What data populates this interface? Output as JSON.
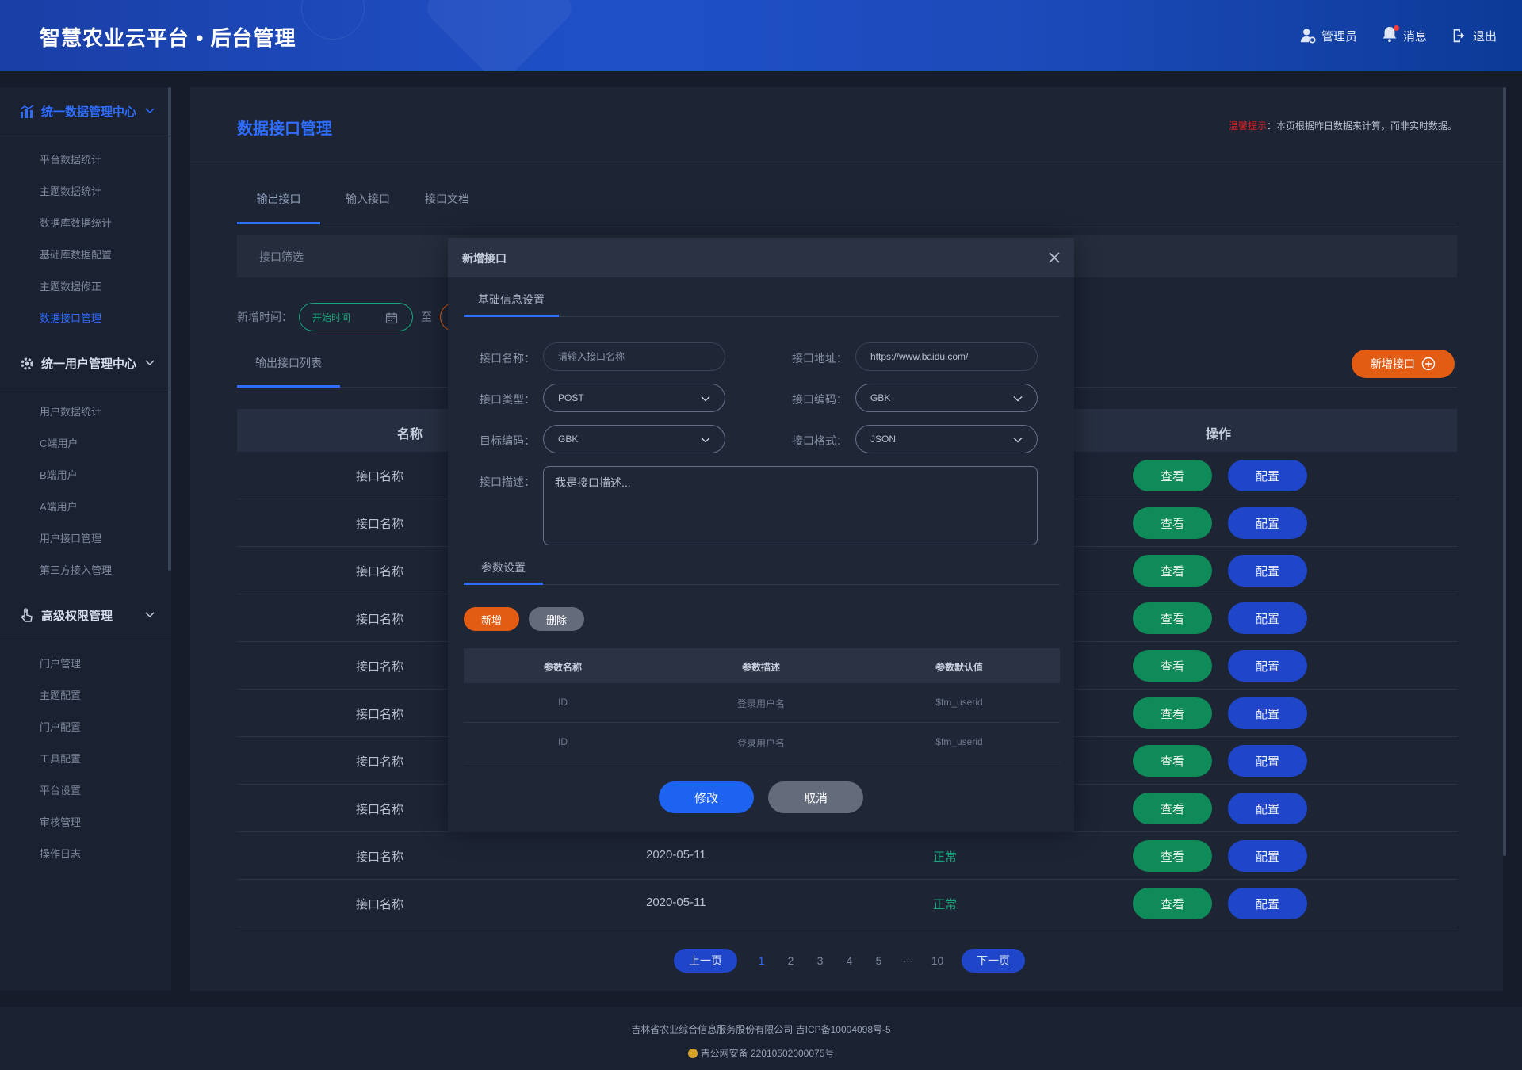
{
  "header": {
    "title": "智慧农业云平台 • 后台管理",
    "admin": "管理员",
    "messages": "消息",
    "logout": "退出"
  },
  "sidebar": {
    "groups": [
      {
        "title": "统一数据管理中心",
        "items": [
          "平台数据统计",
          "主题数据统计",
          "数据库数据统计",
          "基础库数据配置",
          "主题数据修正",
          "数据接口管理"
        ]
      },
      {
        "title": "统一用户管理中心",
        "items": [
          "用户数据统计",
          "C端用户",
          "B端用户",
          "A端用户",
          "用户接口管理",
          "第三方接入管理"
        ]
      },
      {
        "title": "高级权限管理",
        "items": [
          "门户管理",
          "主题配置",
          "门户配置",
          "工具配置",
          "平台设置",
          "审核管理",
          "操作日志"
        ]
      }
    ]
  },
  "page": {
    "title": "数据接口管理",
    "notice_warn": "温馨提示",
    "notice_text": "：本页根据昨日数据来计算，而非实时数据。",
    "tabs": [
      "输出接口",
      "输入接口",
      "接口文档"
    ],
    "filter_label": "接口筛选",
    "date_label": "新增时间：",
    "date_placeholder": "开始时间",
    "date_to": "至",
    "list_tab": "输出接口列表",
    "add_button": "新增接口"
  },
  "table": {
    "col_name": "名称",
    "col_ops": "操作",
    "rows": [
      {
        "name": "接口名称",
        "date": "",
        "status": ""
      },
      {
        "name": "接口名称",
        "date": "",
        "status": ""
      },
      {
        "name": "接口名称",
        "date": "",
        "status": ""
      },
      {
        "name": "接口名称",
        "date": "",
        "status": ""
      },
      {
        "name": "接口名称",
        "date": "",
        "status": ""
      },
      {
        "name": "接口名称",
        "date": "",
        "status": ""
      },
      {
        "name": "接口名称",
        "date": "",
        "status": ""
      },
      {
        "name": "接口名称",
        "date": "",
        "status": ""
      },
      {
        "name": "接口名称",
        "date": "2020-05-11",
        "status": "正常"
      },
      {
        "name": "接口名称",
        "date": "2020-05-11",
        "status": "正常"
      }
    ],
    "view_label": "查看",
    "config_label": "配置"
  },
  "pager": {
    "prev": "上一页",
    "next": "下一页",
    "pages": [
      "1",
      "2",
      "3",
      "4",
      "5",
      "···",
      "10"
    ],
    "current": "1"
  },
  "footer": {
    "line1": "吉林省农业综合信息服务股份有限公司 吉ICP备10004098号-5",
    "line2": "吉公网安备 22010502000075号"
  },
  "modal": {
    "title": "新增接口",
    "section1": "基础信息设置",
    "name_label": "接口名称：",
    "name_placeholder": "请输入接口名称",
    "addr_label": "接口地址：",
    "addr_value": "https://www.baidu.com/",
    "type_label": "接口类型：",
    "type_value": "POST",
    "enc_label": "接口编码：",
    "enc_value": "GBK",
    "target_label": "目标编码：",
    "target_value": "GBK",
    "format_label": "接口格式：",
    "format_value": "JSON",
    "desc_label": "接口描述：",
    "desc_placeholder": "我是接口描述...",
    "section2": "参数设置",
    "add": "新增",
    "delete": "删除",
    "param_cols": [
      "参数名称",
      "参数描述",
      "参数默认值"
    ],
    "params": [
      {
        "name": "ID",
        "desc": "登录用户名",
        "default": "$fm_userid"
      },
      {
        "name": "ID",
        "desc": "登录用户名",
        "default": "$fm_userid"
      }
    ],
    "submit": "修改",
    "cancel": "取消"
  },
  "colors": {
    "accent": "#2f6dff",
    "view": "#0f8a59",
    "config": "#1f45c8",
    "orange": "#e35c14",
    "status_ok": "#17a57a"
  }
}
